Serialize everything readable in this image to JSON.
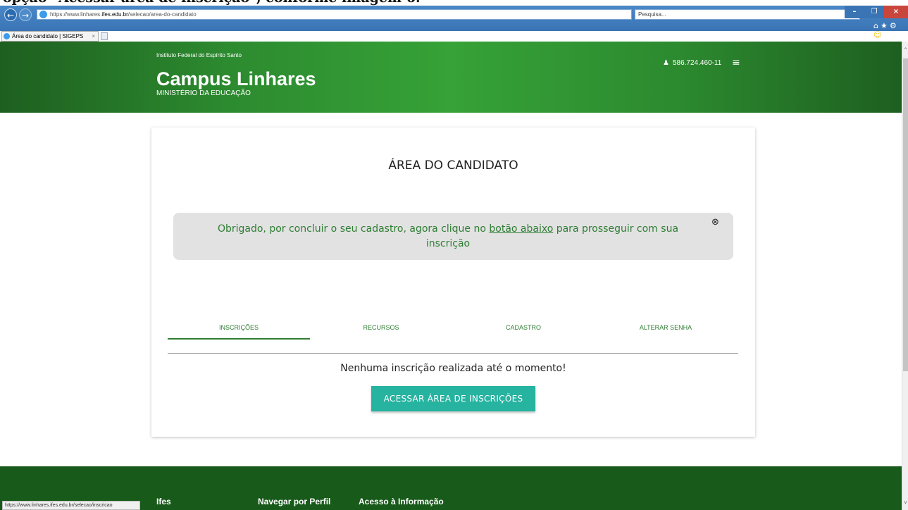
{
  "caption": {
    "text": "opção \"Acessar área de inscrição\", conforme imagem 6."
  },
  "browser": {
    "url_scheme": "https://",
    "url_prefix": "www.linhares.",
    "url_host": "ifes.edu.br",
    "url_path": "/selecao/area-do-candidato",
    "addr_controls": "▾ 🔒 ↻",
    "search_placeholder": "Pesquisa...",
    "tab_title": "Área do candidato | SIGEPS",
    "tab_close": "×",
    "nav_back": "←",
    "nav_forward": "→",
    "window_minimize": "–",
    "window_maximize": "❐",
    "window_close": "×",
    "icons": [
      "home-icon",
      "star-icon",
      "gear-icon",
      "smiley-icon"
    ],
    "status_url": "https://www.linhares.ifes.edu.br/selecao/inscricao"
  },
  "header": {
    "institution": "Instituto Federal do Espírito Santo",
    "title": "Campus Linhares",
    "subtitle": "MINISTÉRIO DA EDUCAÇÃO",
    "user_id": "586.724.460-11",
    "menu_icon": "≡",
    "user_icon": "👤"
  },
  "card": {
    "title": "ÁREA DO CANDIDATO",
    "alert": {
      "text_before": "Obrigado, por concluir o seu cadastro, agora clique no ",
      "link": "botão abaixo",
      "text_after": " para prosseguir com sua inscrição",
      "close_icon": "⊗"
    },
    "tabs": [
      "INSCRIÇÕES",
      "RECURSOS",
      "CADASTRO",
      "ALTERAR SENHA"
    ],
    "empty_message": "Nenhuma inscrição realizada até o momento!",
    "action_button": "ACESSAR ÁREA DE INSCRIÇÕES"
  },
  "footer": {
    "links": [
      "Ifes",
      "Navegar por Perfil",
      "Acesso à Informação"
    ]
  },
  "colors": {
    "header_green": "#2c8a2f",
    "footer_green": "#185a1a",
    "accent_teal": "#26b3a0",
    "alert_text_green": "#2e7d32"
  }
}
